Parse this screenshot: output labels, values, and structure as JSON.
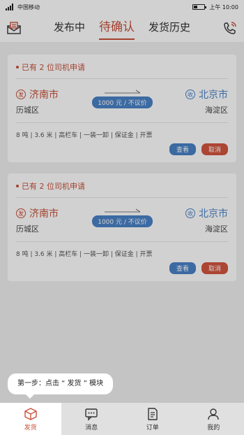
{
  "status_bar": {
    "carrier": "中国移动",
    "time": "上午 10:00"
  },
  "header": {
    "tabs": [
      {
        "label": "发布中"
      },
      {
        "label": "待确认"
      },
      {
        "label": "发货历史"
      }
    ],
    "active_tab": 1,
    "left_icon": "mail-icon",
    "right_icon": "phone-icon"
  },
  "cards": [
    {
      "head": "已有 2 位司机申请",
      "from_badge": "发",
      "from_city": "济南市",
      "from_district": "历城区",
      "to_badge": "收",
      "to_city": "北京市",
      "to_district": "海淀区",
      "price": "1000 元 / 不议价",
      "specs": "8 吨 | 3.6 米 | 高栏车 | 一装一卸 | 保证金 | 开票",
      "view_label": "查看",
      "cancel_label": "取消"
    },
    {
      "head": "已有 2 位司机申请",
      "from_badge": "发",
      "from_city": "济南市",
      "from_district": "历城区",
      "to_badge": "收",
      "to_city": "北京市",
      "to_district": "海淀区",
      "price": "1000 元 / 不议价",
      "specs": "8 吨 | 3.6 米 | 高栏车 | 一装一卸 | 保证金 | 开票",
      "view_label": "查看",
      "cancel_label": "取消"
    }
  ],
  "tooltip": {
    "text": "第一步：点击 “ 发货 ” 模块"
  },
  "bottom_nav": {
    "items": [
      {
        "label": "发货",
        "icon": "box-icon"
      },
      {
        "label": "消息",
        "icon": "chat-icon"
      },
      {
        "label": "订单",
        "icon": "document-icon"
      },
      {
        "label": "我的",
        "icon": "person-icon"
      }
    ]
  },
  "colors": {
    "accent": "#c8503a",
    "blue": "#4a82c6"
  }
}
